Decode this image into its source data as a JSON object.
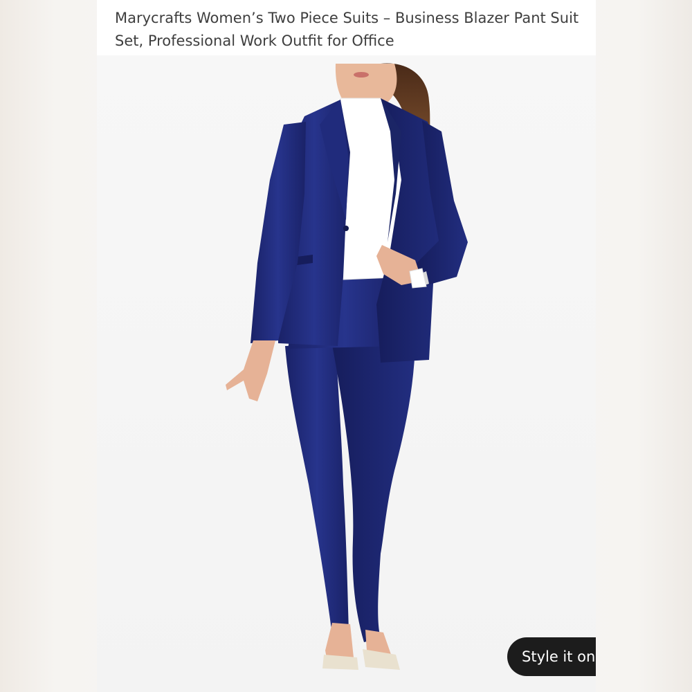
{
  "listing": {
    "title": "Marycrafts Women’s Two Piece Suits – Business Blazer Pant Suit Set, Professional Work Outfit for Office",
    "image": {
      "subject": "product-photo",
      "suit_color": "#1f2a7a",
      "shirt_color": "#ffffff"
    }
  },
  "action": {
    "style_label": "Style it on you",
    "icon": "sparkle-icon",
    "icon_color": "#f0a23a",
    "background": "#1c1c1c"
  }
}
